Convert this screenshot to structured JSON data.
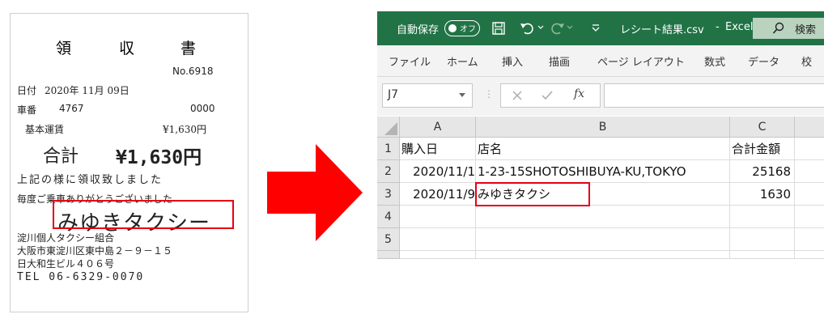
{
  "receipt": {
    "title_chars": [
      "領",
      "収",
      "書"
    ],
    "number": "No.6918",
    "date_label": "日付",
    "date_value": "2020年 11月 09日",
    "car_label": "車番",
    "car_number": "4767",
    "car_code": "0000",
    "fare_label": "基本運賃",
    "fare_value": "¥1,630円",
    "total_label": "合計",
    "total_value": "¥1,630円",
    "message_line1": "上記の様に領収致しました",
    "message_line2": "毎度ご乗車ありがとうございました",
    "company_stamp": "みゆきタクシー",
    "union": "淀川個人タクシー組合",
    "address1": "大阪市東淀川区東中島２－９－１５",
    "address2": "日大和生ビル４０６号",
    "tel": "TEL 06-6329-0070"
  },
  "excel": {
    "autosave_label": "自動保存",
    "autosave_state": "オフ",
    "filename": "レシート結果.csv",
    "app_name": "Excel",
    "search_label": "検索",
    "ribbon_tabs": [
      "ファイル",
      "ホーム",
      "挿入",
      "描画",
      "ページ レイアウト",
      "数式",
      "データ",
      "校"
    ],
    "name_box": "J7",
    "fx_label": "fx",
    "columns": [
      "A",
      "B",
      "C"
    ],
    "row_numbers": [
      "1",
      "2",
      "3",
      "4",
      "5"
    ],
    "rows": [
      [
        "購入日",
        "店名",
        "合計金額"
      ],
      [
        "2020/11/1",
        "1-23-15SHOTOSHIBUYA-KU,TOKYO",
        "25168"
      ],
      [
        "2020/11/9",
        "みゆきタクシ",
        "1630"
      ],
      [
        "",
        "",
        ""
      ],
      [
        "",
        "",
        ""
      ]
    ]
  },
  "colors": {
    "excel_green": "#217346",
    "highlight_red": "#e60012"
  }
}
